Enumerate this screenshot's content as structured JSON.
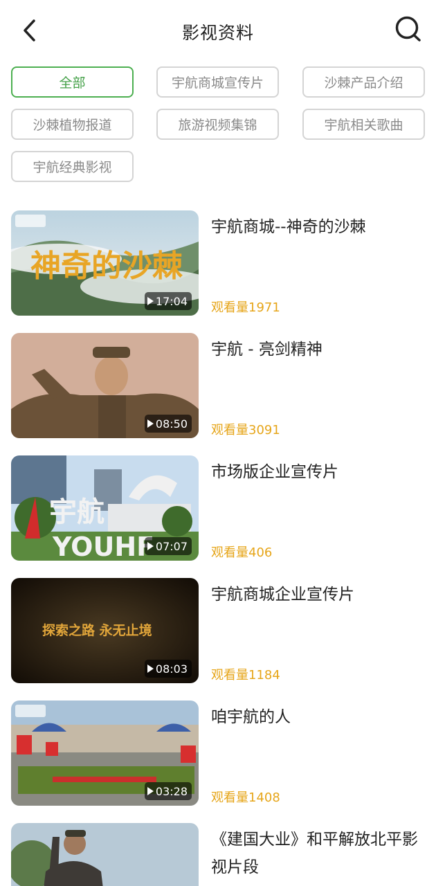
{
  "header": {
    "title": "影视资料",
    "back_icon": "chevron-left-icon",
    "search_icon": "search-icon"
  },
  "filters": [
    {
      "label": "全部",
      "active": true
    },
    {
      "label": "宇航商城宣传片",
      "active": false
    },
    {
      "label": "沙棘产品介绍",
      "active": false
    },
    {
      "label": "沙棘植物报道",
      "active": false
    },
    {
      "label": "旅游视频集锦",
      "active": false
    },
    {
      "label": "宇航相关歌曲",
      "active": false
    },
    {
      "label": "宇航经典影视",
      "active": false
    }
  ],
  "colors": {
    "accent_green": "#4caf50",
    "views_orange": "#e6a519"
  },
  "videos": [
    {
      "title": "宇航商城--神奇的沙棘",
      "duration": "17:04",
      "views": "观看量1971",
      "thumb_text": "神奇的沙棘"
    },
    {
      "title": "宇航 - 亮剑精神",
      "duration": "08:50",
      "views": "观看量3091",
      "thumb_text": ""
    },
    {
      "title": "市场版企业宣传片",
      "duration": "07:07",
      "views": "观看量406",
      "thumb_text": "宇航"
    },
    {
      "title": "宇航商城企业宣传片",
      "duration": "08:03",
      "views": "观看量1184",
      "thumb_text": "探索之路  永无止境"
    },
    {
      "title": "咱宇航的人",
      "duration": "03:28",
      "views": "观看量1408",
      "thumb_text": ""
    },
    {
      "title": "《建国大业》和平解放北平影视片段",
      "duration": "",
      "views": "",
      "thumb_text": ""
    }
  ]
}
